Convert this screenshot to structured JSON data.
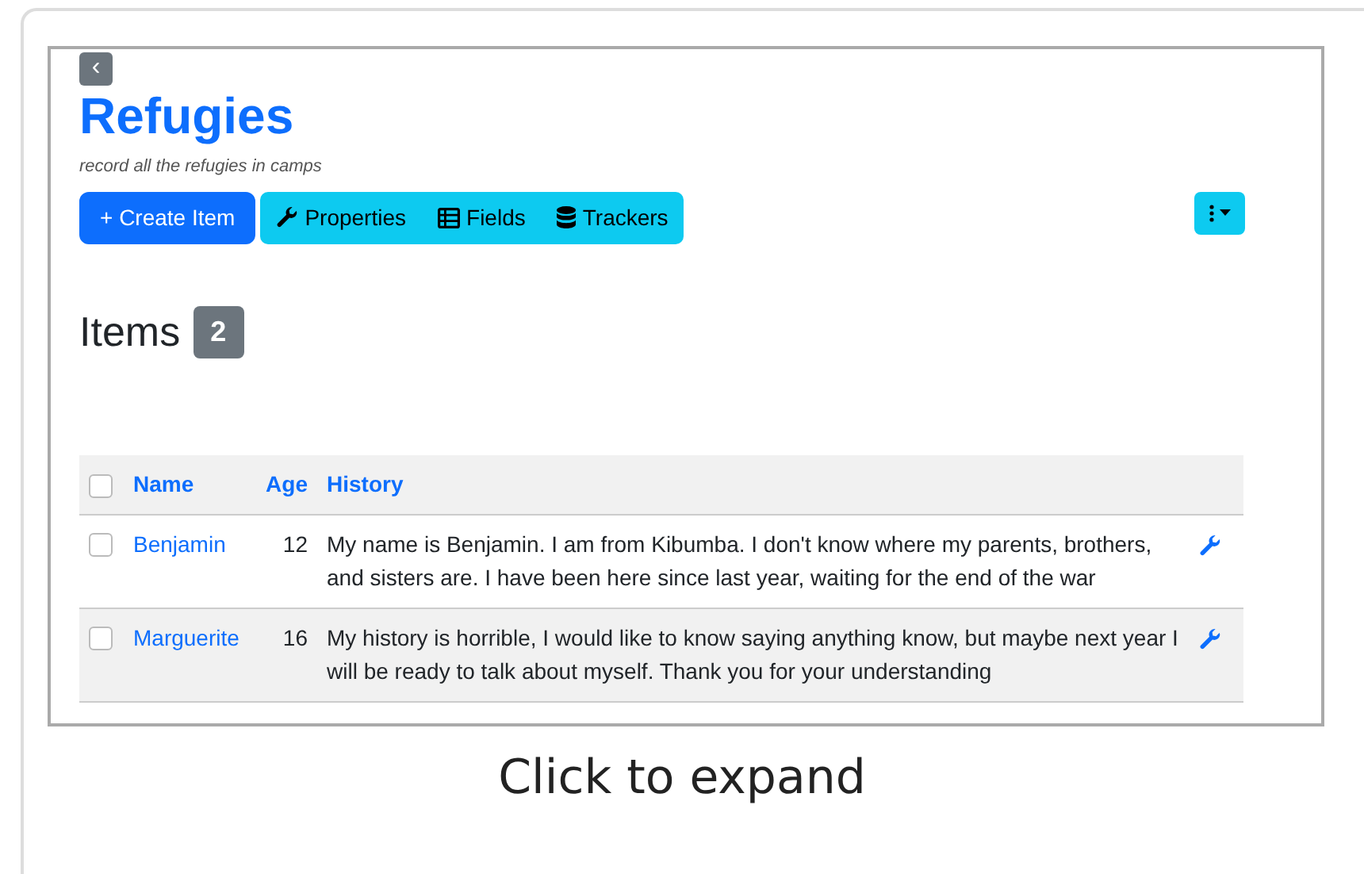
{
  "page": {
    "back_label": "‹",
    "title": "Refugies",
    "subtitle": "record all the refugies in camps"
  },
  "toolbar": {
    "create_button": "+ Create Item",
    "buttons": [
      {
        "label": "Properties",
        "kind": "wrench"
      },
      {
        "label": "Fields",
        "kind": "table"
      },
      {
        "label": "Trackers",
        "kind": "database"
      }
    ]
  },
  "items_heading": {
    "label": "Items",
    "count": "2"
  },
  "table": {
    "header_checked": false,
    "columns": [
      "Name",
      "Age",
      "History"
    ],
    "rows": [
      {
        "checked": false,
        "highlighted": false,
        "name": "Benjamin",
        "age": "12",
        "history": "My name is Benjamin. I am from Kibumba. I don't know where my parents, brothers, and sisters are. I have been here since last year, waiting for the end of the war"
      },
      {
        "checked": false,
        "highlighted": true,
        "name": "Marguerite",
        "age": "16",
        "history": "My history is horrible, I would like to know saying anything know, but maybe next year I will be ready to talk about myself. Thank you for your understanding"
      }
    ]
  },
  "caption": "Click to expand"
}
